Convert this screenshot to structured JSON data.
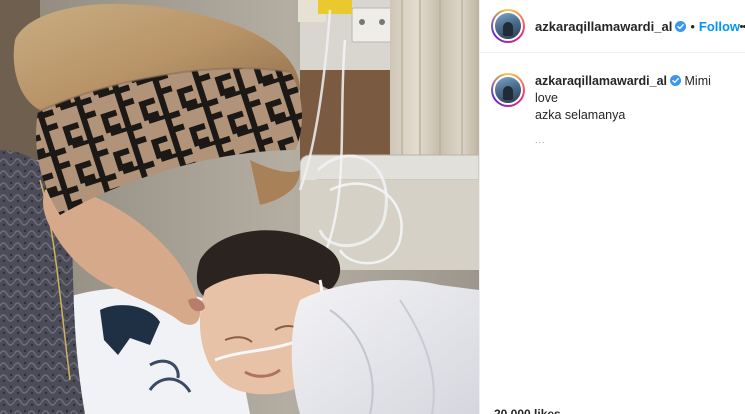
{
  "post": {
    "username": "azkaraqillamawardi_al",
    "follow_label": "Follow",
    "separator": "•",
    "caption_line1": "Mimi love",
    "caption_line2": "azka selamanya",
    "caption_meta": "...",
    "likes_text": "20,000 likes",
    "icons": {
      "verified": "verified-badge-icon",
      "more": "more-options-icon"
    }
  },
  "colors": {
    "follow": "#0095f6",
    "verified": "#3897f0",
    "text": "#262626",
    "meta": "#8e8e8e"
  }
}
